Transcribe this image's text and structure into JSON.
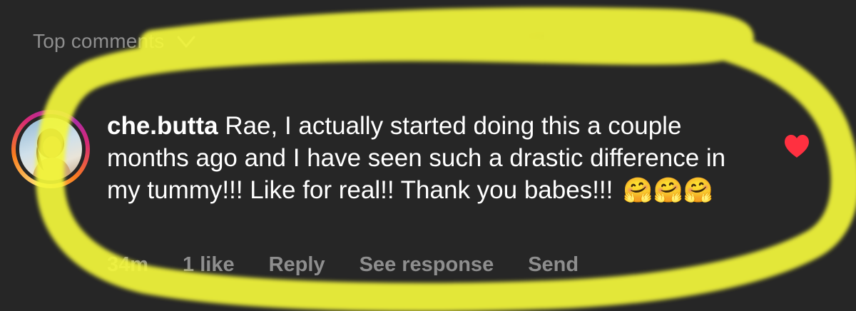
{
  "header": {
    "sort_label": "Top comments"
  },
  "comment": {
    "username": "che.butta",
    "text": "Rae, I actually started doing this a couple months ago and I have seen such a drastic difference in my tummy!!! Like for real!! Thank you babes!!!",
    "emojis": "🤗🤗🤗",
    "liked": true
  },
  "actions": {
    "time": "34m",
    "likes": "1 like",
    "reply": "Reply",
    "see_response": "See response",
    "send": "Send"
  },
  "colors": {
    "background": "#262626",
    "muted_text": "#8e8e8e",
    "heart": "#ff3040",
    "highlight": "#f4f83a"
  },
  "icons": {
    "sort": "chevron-down-icon",
    "like": "heart-icon"
  }
}
